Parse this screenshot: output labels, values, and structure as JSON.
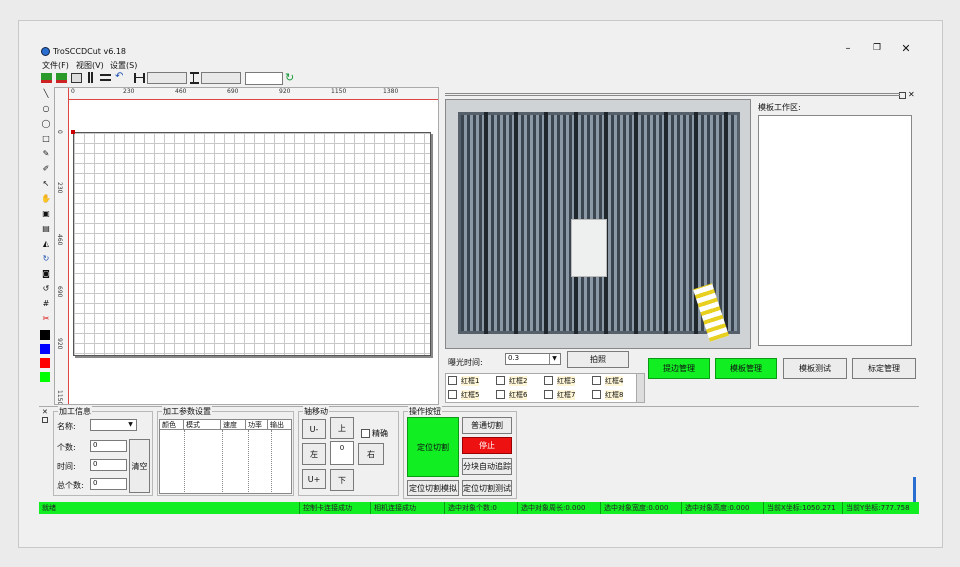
{
  "app": {
    "title": "TroSCCDCut v6.18"
  },
  "menu": [
    "文件(F)",
    "视图(V)",
    "设置(S)"
  ],
  "toolbar": {
    "width_value": "",
    "height_value": "",
    "zoom_value": ""
  },
  "ruler": {
    "top_ticks": [
      "0",
      "230",
      "460",
      "690",
      "920",
      "1150",
      "1380"
    ],
    "left_ticks": [
      "0",
      "230",
      "460",
      "690",
      "920",
      "1150"
    ]
  },
  "palette": {
    "colors": [
      "#000000",
      "#0000ff",
      "#ff0000",
      "#00ff00"
    ]
  },
  "exposure": {
    "label": "曝光时间:",
    "value": "0.3",
    "photo_button": "拍照"
  },
  "template_panel": {
    "title": "模板工作区:"
  },
  "management": {
    "edge": "提边管理",
    "template": "模板管理",
    "test": "模板测试",
    "calibrate": "标定管理"
  },
  "red_boxes": [
    "红框1",
    "红框2",
    "红框3",
    "红框4",
    "红框5",
    "红框6",
    "红框7",
    "红框8"
  ],
  "process_info": {
    "title": "加工信息",
    "name_label": "名称:",
    "name_value": "",
    "count_label": "个数:",
    "count_value": "0",
    "time_label": "时间:",
    "time_value": "0",
    "total_label": "总个数:",
    "total_value": "0",
    "clear_button": "清空"
  },
  "params": {
    "title": "加工参数设置",
    "columns": [
      "颜色",
      "模式",
      "速度",
      "功率",
      "输出"
    ]
  },
  "axis_move": {
    "title": "轴移动",
    "up": "上",
    "down": "下",
    "left": "左",
    "right": "右",
    "u_minus": "U-",
    "u_plus": "U+",
    "step_value": "0",
    "precise_label": "精确"
  },
  "operation": {
    "title": "操作按钮",
    "locate_cut": "定位切割",
    "normal_cut": "普通切割",
    "stop": "停止",
    "block_track": "分块自动追踪",
    "locate_simulate": "定位切割模拟",
    "locate_test": "定位切割测试"
  },
  "status": {
    "ready": "就绪",
    "card": "控制卡连接成功",
    "camera": "相机连接成功",
    "count": "选中对象个数:0",
    "perimeter": "选中对象周长:0.000",
    "width": "选中对象宽度:0.000",
    "height": "选中对象高度:0.000",
    "x": "当前X坐标:1050.271",
    "y": "当前Y坐标:777.758"
  },
  "colors": {
    "status_green": "#11ee22",
    "stop_red": "#ee1111",
    "canvas_grid": "#c8c8c8"
  }
}
